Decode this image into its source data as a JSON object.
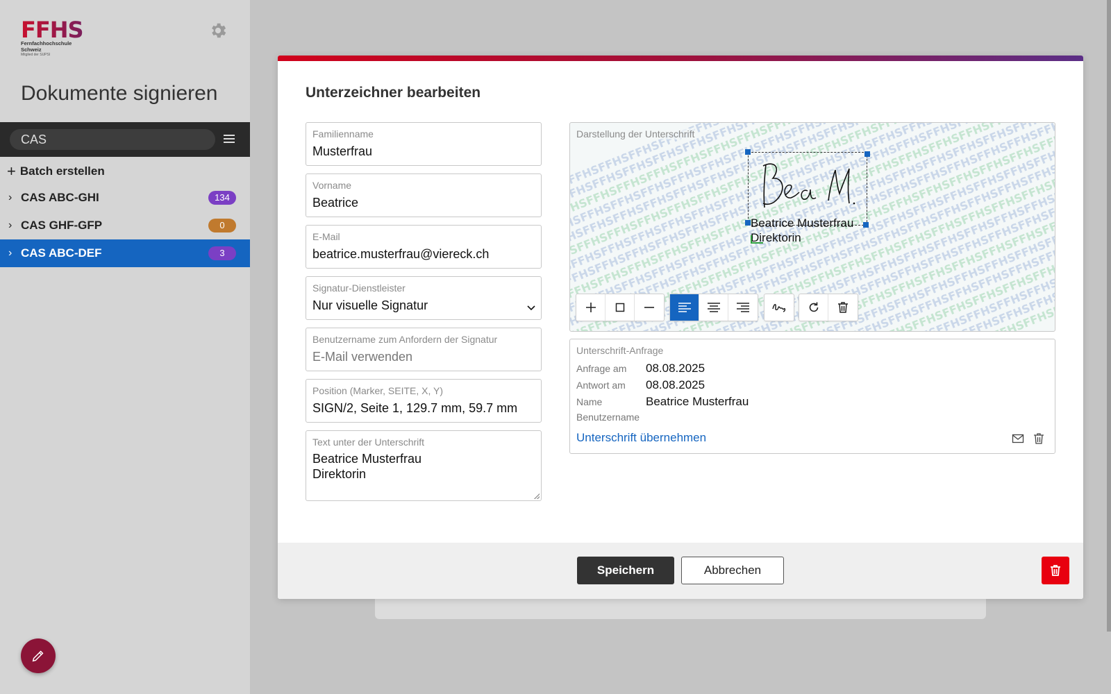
{
  "brand": {
    "logo_text": "FFHS",
    "logo_subtitle_1": "Fernfachhochschule",
    "logo_subtitle_2": "Schweiz",
    "logo_tagline": "Mitglied der SUPSI",
    "primary_color": "#8b1437",
    "accent_color": "#1565c0"
  },
  "sidebar": {
    "title": "Dokumente signieren",
    "search_value": "CAS",
    "batch_label": "Batch erstellen",
    "items": [
      {
        "label": "CAS ABC-GHI",
        "count": "134",
        "badge_color": "#7b3fc4",
        "active": false
      },
      {
        "label": "CAS GHF-GFP",
        "count": "0",
        "badge_color": "#c07a2e",
        "active": false
      },
      {
        "label": "CAS ABC-DEF",
        "count": "3",
        "badge_color": "#7b3fc4",
        "active": true
      }
    ]
  },
  "modal": {
    "title": "Unterzeichner bearbeiten",
    "fields": {
      "lastname": {
        "label": "Familienname",
        "value": "Musterfrau"
      },
      "firstname": {
        "label": "Vorname",
        "value": "Beatrice"
      },
      "email": {
        "label": "E-Mail",
        "value": "beatrice.musterfrau@viereck.ch"
      },
      "provider": {
        "label": "Signatur-Dienstleister",
        "value": "Nur visuelle Signatur"
      },
      "username": {
        "label": "Benutzername zum Anfordern der Signatur",
        "placeholder": "E-Mail verwenden"
      },
      "position": {
        "label": "Position (Marker, SEITE, X, Y)",
        "value": "SIGN/2, Seite 1, 129.7 mm, 59.7 mm"
      },
      "signature_text": {
        "label": "Text unter der Unterschrift",
        "value": "Beatrice Musterfrau\nDirektorin"
      }
    },
    "signature_preview": {
      "label": "Darstellung der Unterschrift",
      "handwriting": "Bea M.",
      "text": "Beatrice Musterfrau\nDirektorin",
      "pattern_word": "FFHS"
    },
    "toolbar": [
      {
        "group": "size",
        "buttons": [
          "plus-icon",
          "square-icon",
          "minus-icon"
        ]
      },
      {
        "group": "align",
        "buttons": [
          "align-left-icon",
          "align-center-icon",
          "align-right-icon"
        ],
        "active": "align-left-icon"
      },
      {
        "group": "signature",
        "buttons": [
          "signature-icon"
        ]
      },
      {
        "group": "edit",
        "buttons": [
          "rotate-icon",
          "trash-icon"
        ]
      }
    ],
    "request": {
      "label": "Unterschrift-Anfrage",
      "rows": [
        {
          "key": "Anfrage am",
          "value": "08.08.2025"
        },
        {
          "key": "Antwort am",
          "value": "08.08.2025"
        },
        {
          "key": "Name",
          "value": "Beatrice Musterfrau"
        },
        {
          "key": "Benutzername",
          "value": ""
        }
      ],
      "adopt_link": "Unterschrift übernehmen"
    },
    "footer": {
      "save_label": "Speichern",
      "cancel_label": "Abbrechen",
      "delete_color": "#e8000f"
    }
  }
}
